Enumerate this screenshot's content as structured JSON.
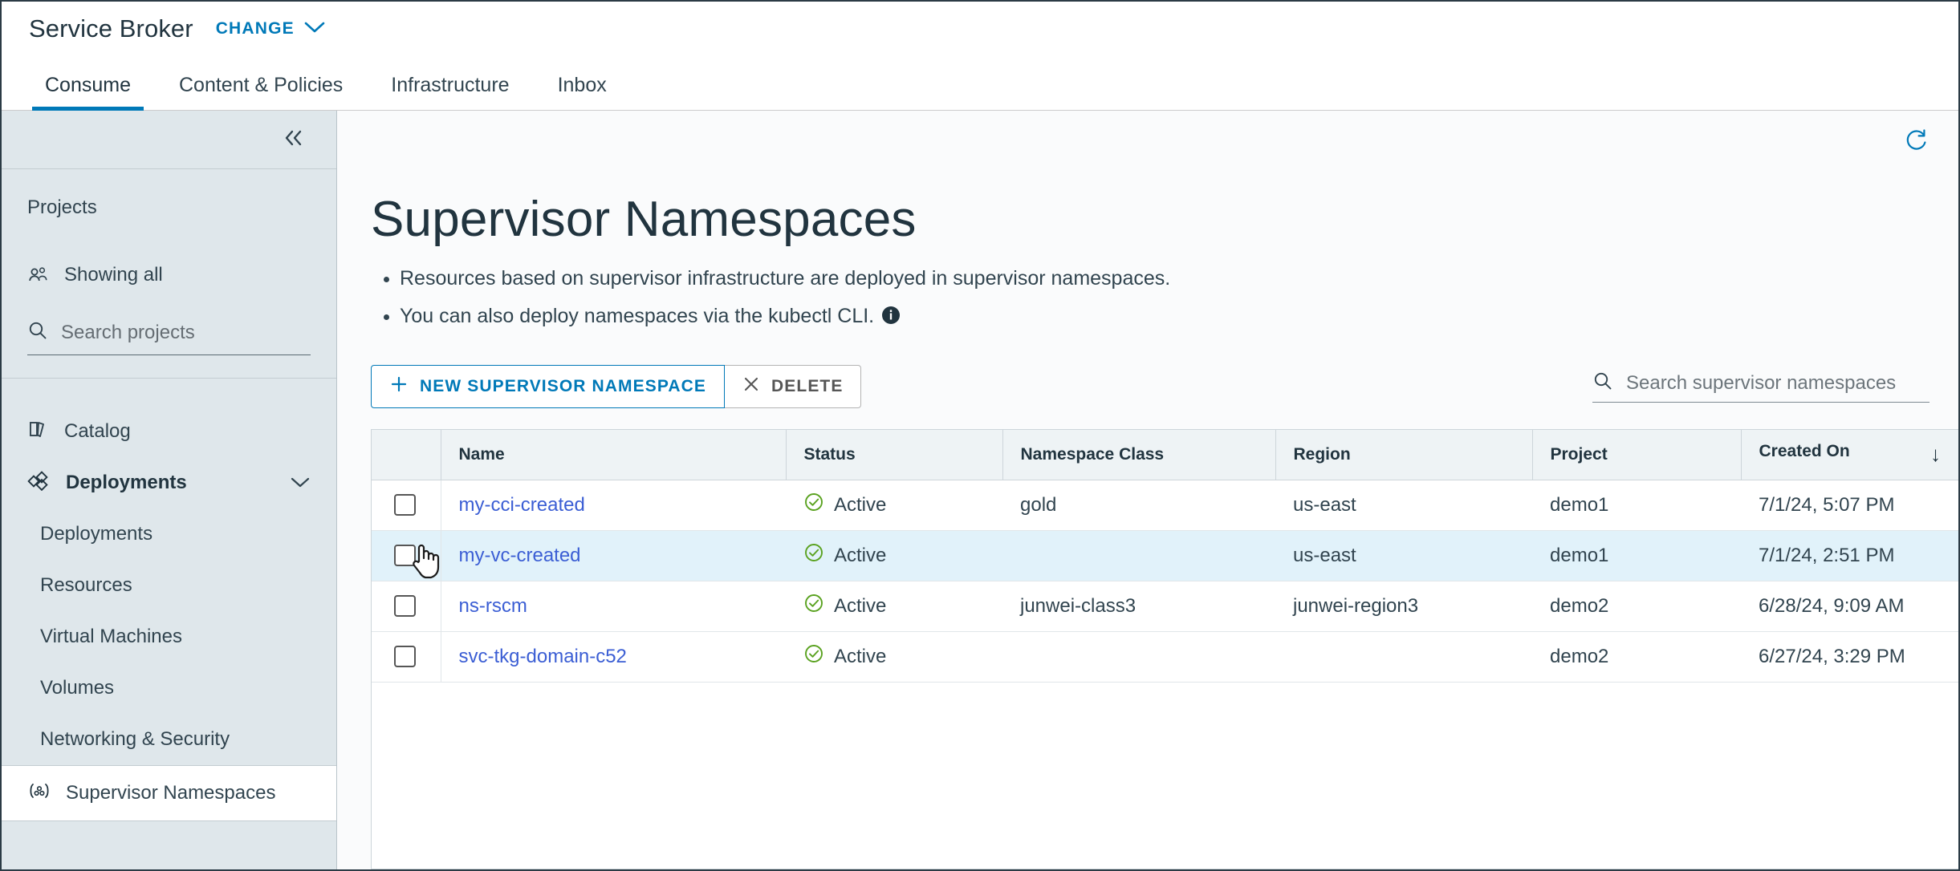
{
  "header": {
    "brand": "Service Broker",
    "change_label": "CHANGE",
    "chevron_icon": "chevron-down-icon"
  },
  "tabs": [
    {
      "label": "Consume",
      "active": true
    },
    {
      "label": "Content & Policies",
      "active": false
    },
    {
      "label": "Infrastructure",
      "active": false
    },
    {
      "label": "Inbox",
      "active": false
    }
  ],
  "sidebar": {
    "collapse_icon": "double-chevron-left-icon",
    "projects_heading": "Projects",
    "showing_all": "Showing all",
    "showing_all_icon": "users-group-icon",
    "search_placeholder": "Search projects",
    "search_value": "",
    "search_icon": "search-icon",
    "catalog": "Catalog",
    "catalog_icon": "catalog-book-icon",
    "deployments_group": "Deployments",
    "deployments_icon": "deployments-blocks-icon",
    "deployments_chevron": "chevron-down-icon",
    "sub_items": [
      "Deployments",
      "Resources",
      "Virtual Machines",
      "Volumes",
      "Networking & Security"
    ],
    "supervisor_namespaces": "Supervisor Namespaces",
    "supervisor_icon": "namespace-icon"
  },
  "main": {
    "refresh_icon": "refresh-icon",
    "title": "Supervisor Namespaces",
    "bullets": [
      "Resources based on supervisor infrastructure are deployed in supervisor namespaces.",
      "You can also deploy namespaces via the kubectl CLI."
    ],
    "info_icon": "info-circle-icon",
    "toolbar": {
      "new_label": "NEW SUPERVISOR NAMESPACE",
      "new_icon": "plus-icon",
      "delete_label": "DELETE",
      "delete_icon": "close-x-icon",
      "search_placeholder": "Search supervisor namespaces",
      "search_value": "",
      "search_icon": "search-icon"
    },
    "table": {
      "columns": [
        "Name",
        "Status",
        "Namespace Class",
        "Region",
        "Project",
        "Created On"
      ],
      "sort_column": "Created On",
      "sort_direction_icon": "arrow-down-icon",
      "status_icon": "check-circle-icon",
      "rows": [
        {
          "checked": false,
          "selected": false,
          "name": "my-cci-created",
          "status": "Active",
          "namespace_class": "gold",
          "region": "us-east",
          "project": "demo1",
          "created_on": "7/1/24, 5:07 PM"
        },
        {
          "checked": false,
          "selected": true,
          "name": "my-vc-created",
          "status": "Active",
          "namespace_class": "",
          "region": "us-east",
          "project": "demo1",
          "created_on": "7/1/24, 2:51 PM"
        },
        {
          "checked": false,
          "selected": false,
          "name": "ns-rscm",
          "status": "Active",
          "namespace_class": "junwei-class3",
          "region": "junwei-region3",
          "project": "demo2",
          "created_on": "6/28/24, 9:09 AM"
        },
        {
          "checked": false,
          "selected": false,
          "name": "svc-tkg-domain-c52",
          "status": "Active",
          "namespace_class": "",
          "region": "",
          "project": "demo2",
          "created_on": "6/27/24, 3:29 PM"
        }
      ]
    }
  },
  "colors": {
    "accent": "#0079b8",
    "link": "#3b5ed4",
    "status_active": "#5aa220",
    "sidebar_bg": "#dfe7eb",
    "selected_row": "#e1f2fa"
  }
}
